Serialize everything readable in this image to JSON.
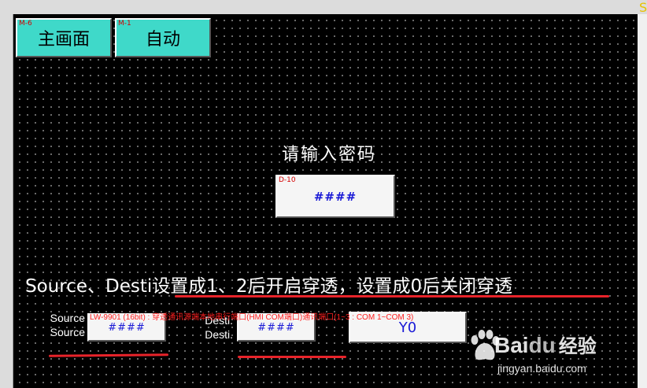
{
  "corner_mark": "S",
  "nav": {
    "main_screen": {
      "tag": "M-6",
      "label": "主画面"
    },
    "auto": {
      "tag": "M-1",
      "label": "自动"
    }
  },
  "password": {
    "prompt": "请输入密码",
    "field_tag": "D-10",
    "field_value": "####"
  },
  "instruction": "Source、Desti设置成1、2后开启穿透，设置成0后关闭穿透",
  "source": {
    "label_line1": "Source",
    "label_line2": "Source",
    "value": "####"
  },
  "desti": {
    "label_line1": "Desti.",
    "label_line2": "Desti.",
    "value": "####"
  },
  "y0_button": {
    "label": "Y0"
  },
  "overlay_note": "LW-9901 (16bit) : 穿透通讯源端本地串行端口(HMI COM端口)通讯端口(1~3 : COM 1~COM 3)",
  "watermark": {
    "brand_latin": "Bai",
    "brand_du": "du",
    "brand_cn": "经验",
    "site": "jingyan.baidu.com"
  },
  "colors": {
    "canvas": "#000000",
    "nav_button": "#3fd9c9",
    "value_text": "#1a1ad6",
    "tag_text": "#d40000",
    "underline": "#e8232a"
  }
}
